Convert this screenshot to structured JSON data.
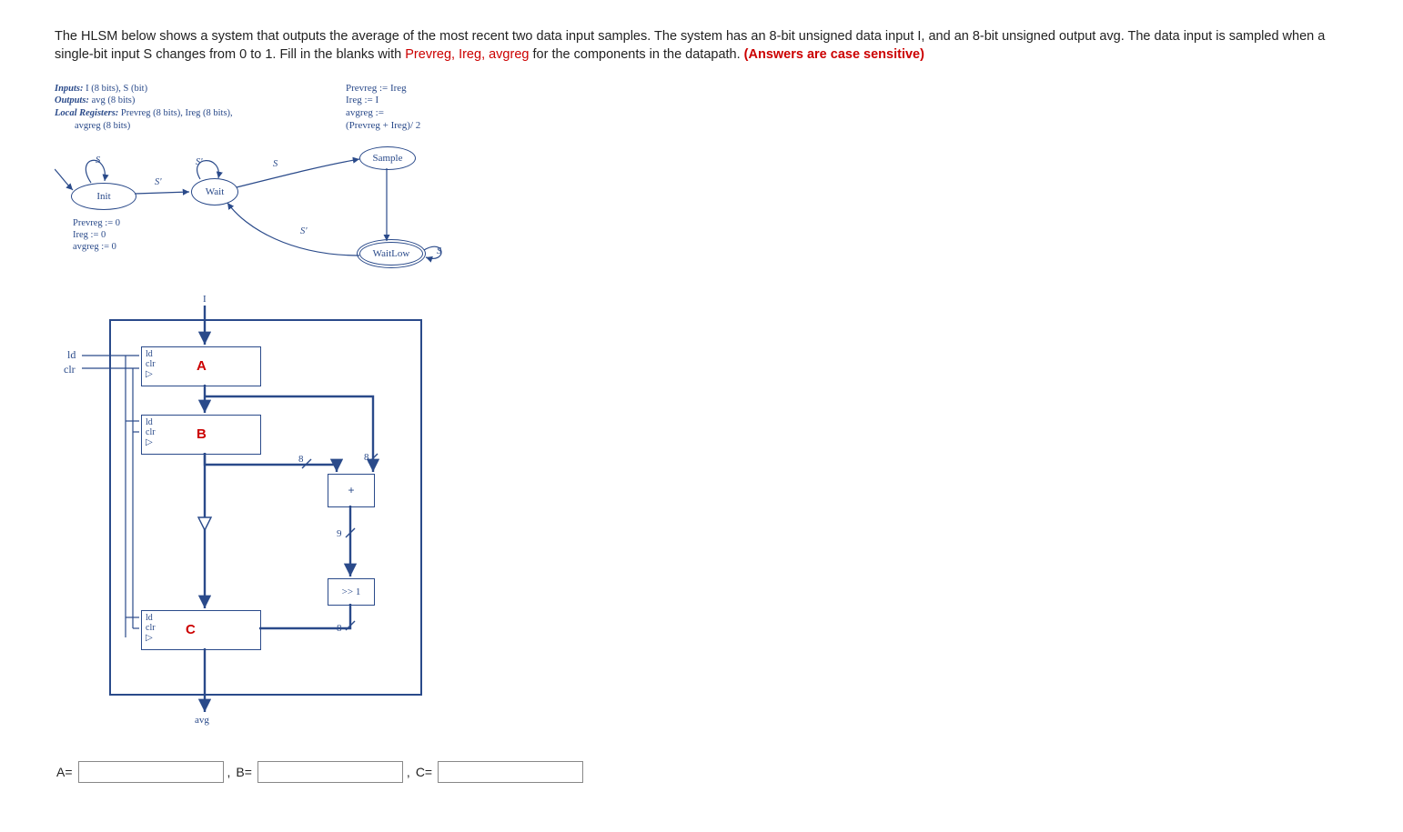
{
  "question": {
    "part1": "The HLSM below shows a system that outputs the average of the most recent two data input samples. The system has an 8-bit unsigned data input I, and an 8-bit unsigned output avg. The data input is sampled when a single-bit input S changes from 0 to 1. Fill in the blanks with ",
    "keywords": "Prevreg, Ireg, avgreg",
    "part2": " for the components in the datapath. ",
    "case_note": "(Answers are case sensitive)"
  },
  "declarations": {
    "inputs_label": "Inputs:",
    "inputs_val": " I (8 bits), S (bit)",
    "outputs_label": "Outputs:",
    "outputs_val": " avg (8 bits)",
    "locals_label": "Local Registers:",
    "locals_val": " Prevreg (8 bits), Ireg (8 bits),",
    "locals_cont": "avgreg (8 bits)"
  },
  "sample_actions": {
    "l1": "Prevreg := Ireg",
    "l2": "Ireg := I",
    "l3": "avgreg :=",
    "l4": "(Prevreg + Ireg)/ 2"
  },
  "states": {
    "init": "Init",
    "wait": "Wait",
    "sample": "Sample",
    "waitlow": "WaitLow"
  },
  "init_actions": {
    "l1": "Prevreg := 0",
    "l2": "Ireg := 0",
    "l3": "avgreg := 0"
  },
  "trans": {
    "s": "S",
    "sp": "S'",
    "s_low": "S"
  },
  "regs": {
    "A": "A",
    "B": "B",
    "C": "C",
    "ld": "ld",
    "clr": "clr"
  },
  "ops": {
    "plus": "+",
    "shift": ">> 1"
  },
  "sigs": {
    "I": "I",
    "avg": "avg",
    "ld_ext": "ld",
    "clr_ext": "clr",
    "w8a": "8",
    "w8b": "8",
    "w9": "9",
    "w8c": "8"
  },
  "answers": {
    "A_label": "A=",
    "B_label": "B=",
    "C_label": "C=",
    "comma": ","
  }
}
